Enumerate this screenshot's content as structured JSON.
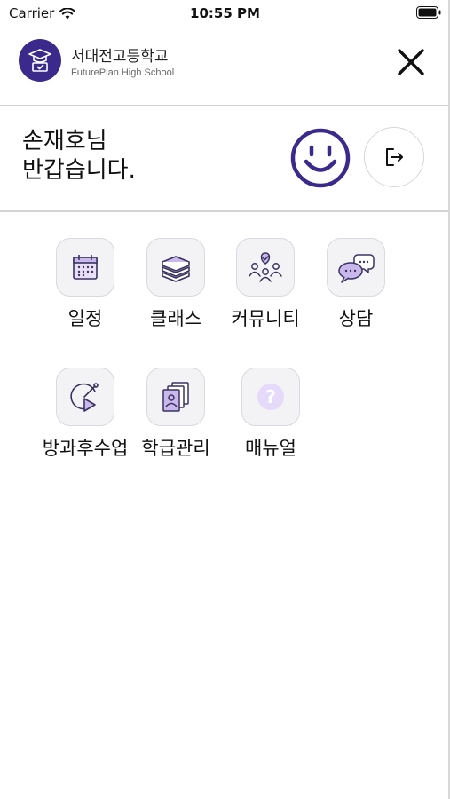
{
  "status": {
    "carrier": "Carrier",
    "time": "10:55 PM"
  },
  "header": {
    "school_name": "서대전고등학교",
    "school_sub": "FuturePlan High School"
  },
  "welcome": {
    "line1": "손재호님",
    "line2": "반갑습니다."
  },
  "menu": [
    {
      "label": "일정",
      "icon": "calendar-icon"
    },
    {
      "label": "클래스",
      "icon": "books-icon"
    },
    {
      "label": "커뮤니티",
      "icon": "community-icon"
    },
    {
      "label": "상담",
      "icon": "chat-bubbles-icon"
    },
    {
      "label": "방과후수업",
      "icon": "after-school-icon"
    },
    {
      "label": "학급관리",
      "icon": "class-cards-icon"
    },
    {
      "label": "매뉴얼",
      "icon": "help-icon"
    }
  ],
  "colors": {
    "accent": "#3b2a8c",
    "icon_fill": "#c9b8ec",
    "icon_stroke": "#3a3360"
  }
}
